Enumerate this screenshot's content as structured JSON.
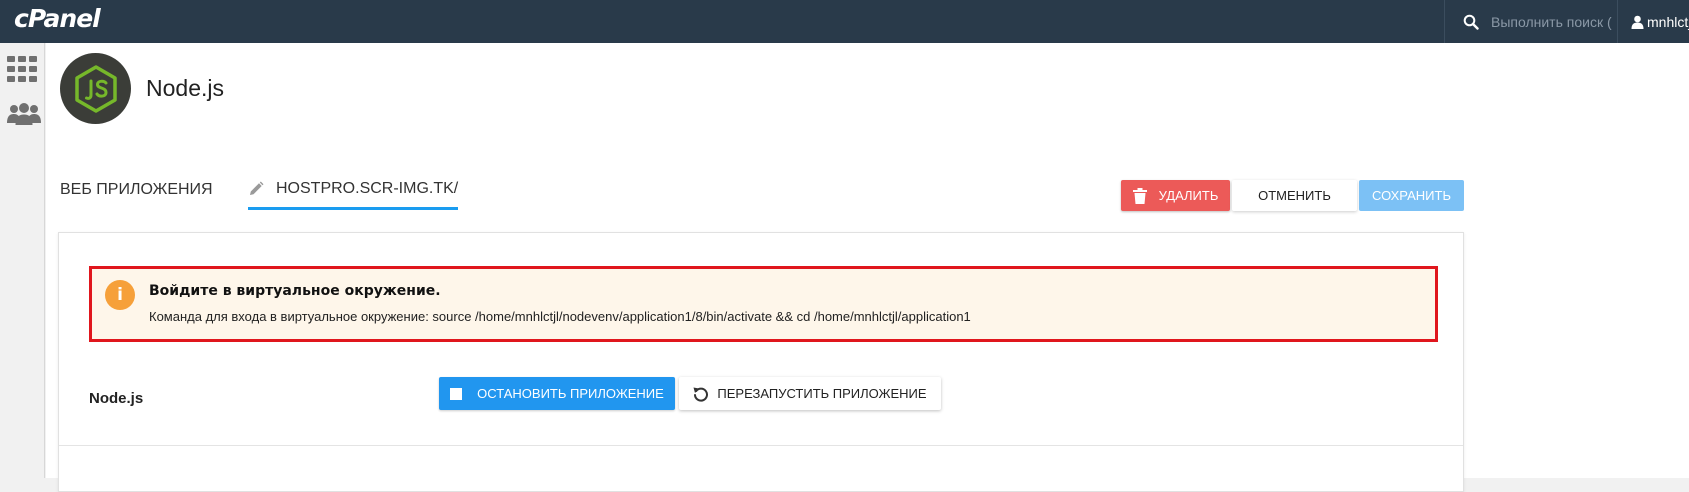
{
  "topbar": {
    "brand": "cPanel",
    "search_placeholder": "Выполнить поиск (",
    "username": "mnhlctjl"
  },
  "sidebar": {
    "icons": [
      "grid-icon",
      "users-icon"
    ]
  },
  "app": {
    "title": "Node.js"
  },
  "tabs": {
    "web_apps": "ВЕБ ПРИЛОЖЕНИЯ",
    "current_app": "HOSTPRO.SCR-IMG.TK/"
  },
  "actions": {
    "delete": "УДАЛИТЬ",
    "cancel": "ОТМЕНИТЬ",
    "save": "СОХРАНИТЬ"
  },
  "alert": {
    "title": "Войдите в виртуальное окружение.",
    "text": "Команда для входа в виртуальное окружение: source /home/mnhlctjl/nodevenv/application1/8/bin/activate && cd /home/mnhlctjl/application1"
  },
  "controls": {
    "label": "Node.js",
    "stop": "ОСТАНОВИТЬ ПРИЛОЖЕНИЕ",
    "restart": "ПЕРЕЗАПУСТИТЬ ПРИЛОЖЕНИЕ"
  },
  "colors": {
    "topbar": "#293a4a",
    "primary": "#2196ef",
    "danger": "#ec5a58",
    "save_disabled": "#7cc1f5",
    "alert_bg": "#fef6ea",
    "alert_border": "#e0161d",
    "alert_icon": "#f6a03a"
  }
}
